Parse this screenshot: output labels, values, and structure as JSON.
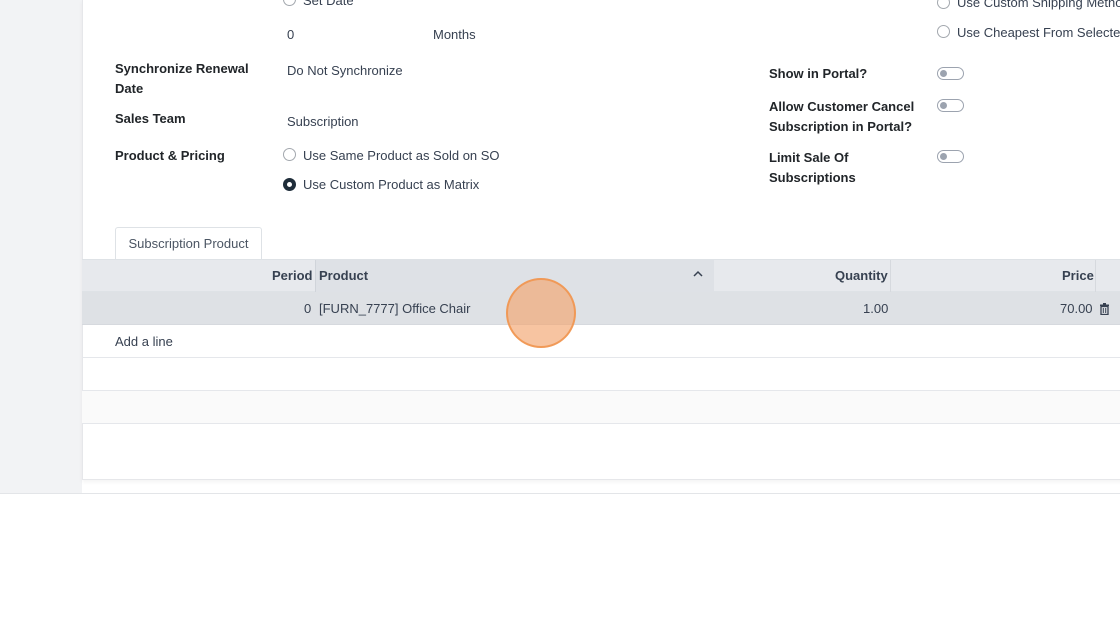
{
  "form": {
    "set_date_label": "Set Date",
    "duration_value": "0",
    "duration_unit": "Months",
    "sync_label_line1": "Synchronize Renewal",
    "sync_label_line2": "Date",
    "sync_value": "Do Not Synchronize",
    "sales_team_label": "Sales Team",
    "sales_team_value": "Subscription",
    "product_pricing_label": "Product & Pricing",
    "pricing_option_1": "Use Same Product as Sold on SO",
    "pricing_option_2": "Use Custom Product as Matrix",
    "pricing_selected": "Use Custom Product as Matrix",
    "shipping_option_1": "Use Custom Shipping Metho",
    "shipping_option_2": "Use Cheapest From Selecte",
    "show_portal_label": "Show in Portal?",
    "show_portal_value": false,
    "allow_cancel_line1": "Allow Customer Cancel",
    "allow_cancel_line2": "Subscription in Portal?",
    "allow_cancel_value": false,
    "limit_sale_line1": "Limit Sale Of",
    "limit_sale_line2": "Subscriptions",
    "limit_sale_value": false
  },
  "tabs": [
    {
      "label": "Subscription Product",
      "active": true
    }
  ],
  "table": {
    "columns": [
      "Period",
      "Product",
      "Quantity",
      "Price"
    ],
    "rows": [
      {
        "period": "0",
        "product": "[FURN_7777] Office Chair",
        "quantity": "1.00",
        "price": "70.00"
      }
    ],
    "add_line_label": "Add a line"
  },
  "icons": {
    "sort": "chevron-up-icon",
    "delete": "trash-icon"
  }
}
